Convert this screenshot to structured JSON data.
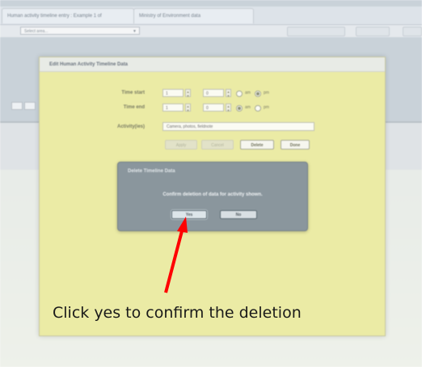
{
  "browser": {
    "tabs": [
      {
        "label": "Human activity timeline entry : Example 1 of"
      },
      {
        "label": "Ministry of Environment data"
      }
    ],
    "select": {
      "value": "Select area..."
    }
  },
  "dialog": {
    "title": "Edit Human Activity Timeline Data",
    "time_start": {
      "label": "Time start",
      "hour": "1",
      "minute": "0",
      "am_label": "am",
      "pm_label": "pm",
      "selected": "pm"
    },
    "time_end": {
      "label": "Time end",
      "hour": "1",
      "minute": "0",
      "am_label": "am",
      "pm_label": "pm",
      "selected": "am"
    },
    "activity": {
      "label": "Activity(ies)",
      "value": "Camera, photos, fieldnote"
    },
    "buttons": {
      "apply": "Apply",
      "cancel": "Cancel",
      "delete": "Delete",
      "done": "Done"
    }
  },
  "confirm_modal": {
    "title": "Delete Timeline Data",
    "message": "Confirm deletion of data for activity shown.",
    "yes": "Yes",
    "no": "No"
  },
  "annotation": {
    "text": "Click yes to confirm the deletion",
    "arrow_color": "#ff0000"
  },
  "colors": {
    "dialog_bg": "#ebeba5",
    "modal_bg": "#8a969d"
  }
}
